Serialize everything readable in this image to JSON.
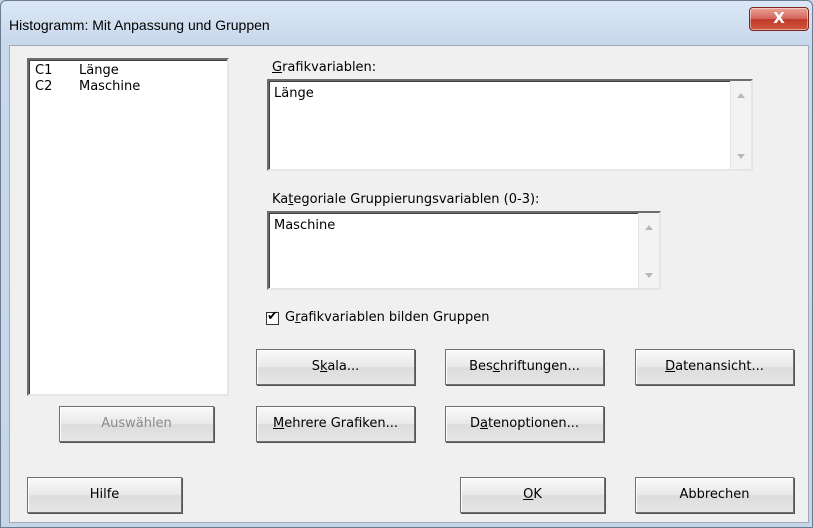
{
  "window": {
    "title": "Histogramm: Mit Anpassung und Gruppen",
    "close_glyph": "X"
  },
  "variables": [
    {
      "column": "C1",
      "name": "Länge"
    },
    {
      "column": "C2",
      "name": "Maschine"
    }
  ],
  "graph_variables": {
    "label_first": "G",
    "label_rest": "rafikvariablen:",
    "value": "Länge"
  },
  "grouping_variables": {
    "label_pre": "Ka",
    "label_accel": "t",
    "label_post": "egoriale Gruppierungsvariablen (0-3):",
    "value": "Maschine"
  },
  "checkbox": {
    "label_pre": "G",
    "label_accel": "r",
    "label_post": "afikvariablen bilden Gruppen",
    "checked": true
  },
  "buttons": {
    "scale": {
      "pre": "S",
      "accel": "k",
      "post": "ala..."
    },
    "labels": {
      "pre": "Bes",
      "accel": "c",
      "post": "hriftungen..."
    },
    "data_view": {
      "pre": "",
      "accel": "D",
      "post": "atenansicht..."
    },
    "select": "Auswählen",
    "multiple_graphs": {
      "pre": "",
      "accel": "M",
      "post": "ehrere Grafiken..."
    },
    "data_options": {
      "pre": "D",
      "accel": "a",
      "post": "tenoptionen..."
    },
    "help": "Hilfe",
    "ok": {
      "pre": "",
      "accel": "O",
      "post": "K"
    },
    "cancel": "Abbrechen"
  }
}
